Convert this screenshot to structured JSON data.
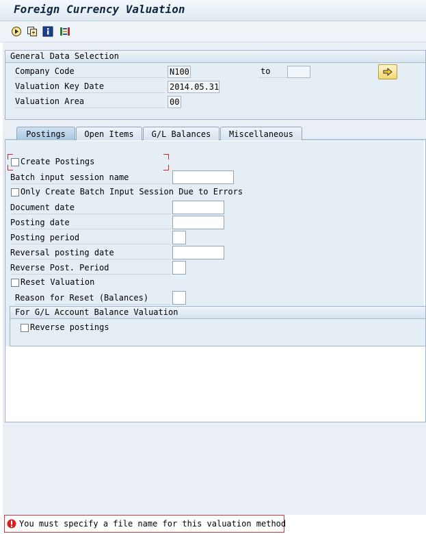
{
  "window": {
    "title": "Foreign Currency Valuation"
  },
  "toolbar": {
    "icons": [
      "execute-icon",
      "copy-variant-icon",
      "info-icon",
      "layout-icon"
    ]
  },
  "general": {
    "header": "General Data Selection",
    "company_code_label": "Company Code",
    "company_code_value": "N100",
    "to_label": "to",
    "to_value": "",
    "valuation_key_date_label": "Valuation Key Date",
    "valuation_key_date_value": "2014.05.31",
    "valuation_area_label": "Valuation Area",
    "valuation_area_value": "00"
  },
  "tabs": [
    {
      "label": "Postings",
      "active": true
    },
    {
      "label": "Open Items",
      "active": false
    },
    {
      "label": "G/L Balances",
      "active": false
    },
    {
      "label": "Miscellaneous",
      "active": false
    }
  ],
  "postings": {
    "create_postings": "Create Postings",
    "batch_input_session_name": "Batch input session name",
    "only_batch_input": "Only Create Batch Input Session Due to Errors",
    "document_date": "Document date",
    "posting_date": "Posting date",
    "posting_period": "Posting period",
    "reversal_posting_date": "Reversal posting date",
    "reverse_post_period": "Reverse Post. Period",
    "reset_valuation": "Reset Valuation",
    "reason_for_reset": "Reason for Reset (Balances)"
  },
  "gl_group": {
    "header": "For G/L Account Balance Valuation",
    "reverse_postings": "Reverse postings"
  },
  "status": {
    "message": "You must specify a file name for this valuation method",
    "type": "error"
  },
  "colors": {
    "error": "#d32222",
    "accent": "#a9c7e3"
  }
}
